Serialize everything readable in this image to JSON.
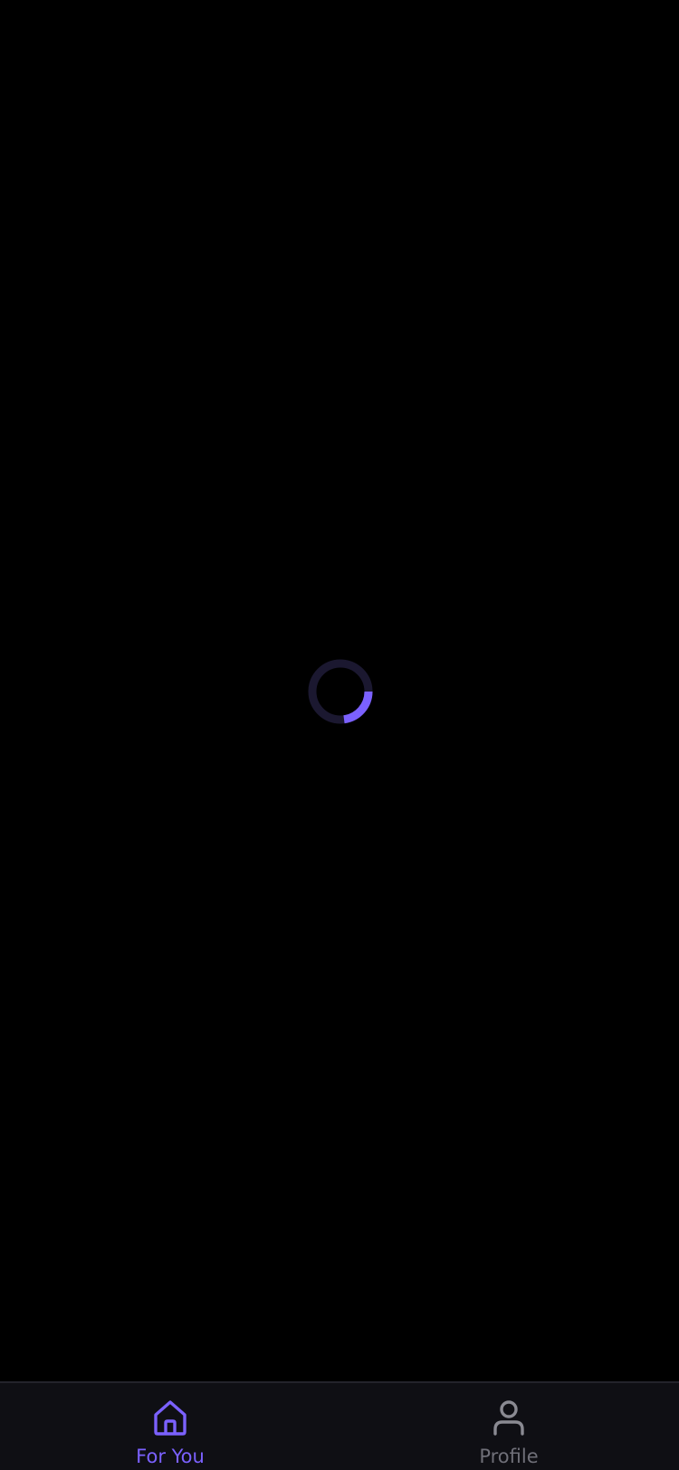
{
  "loading": {
    "spinner_progress": 0.25,
    "accent_color": "#7b61ff",
    "track_color": "#1b1830"
  },
  "tabbar": {
    "tabs": [
      {
        "label": "For You",
        "icon": "home-icon",
        "active": true,
        "color": "#7b61ff"
      },
      {
        "label": "Profile",
        "icon": "user-icon",
        "active": false,
        "color": "#8a8a92"
      }
    ]
  },
  "colors": {
    "background": "#000000",
    "tabbar_background": "#0f0f14"
  }
}
